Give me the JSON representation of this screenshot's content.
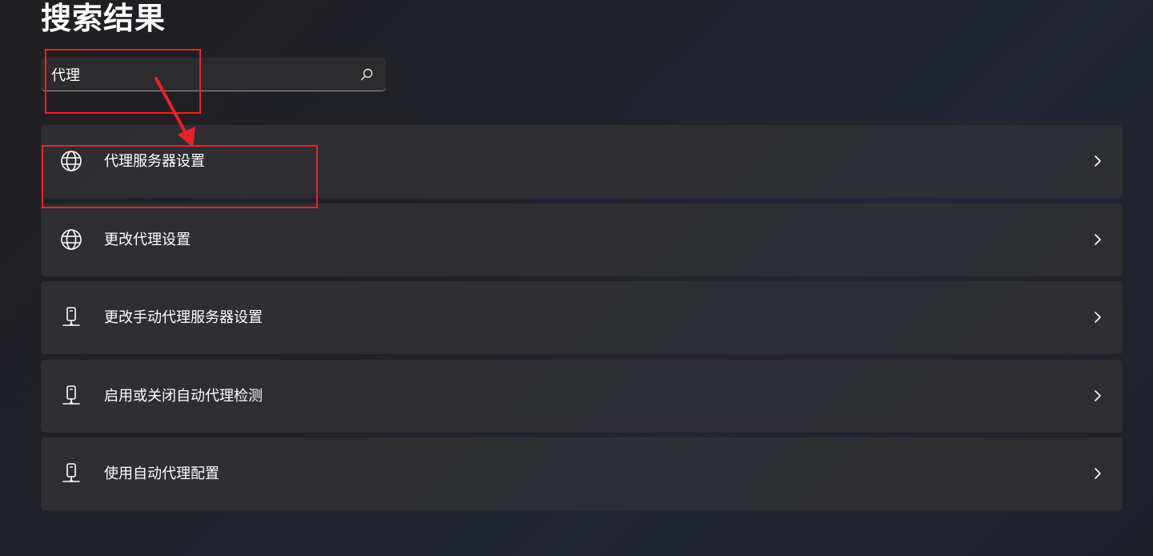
{
  "page": {
    "title": "搜索结果"
  },
  "search": {
    "value": "代理",
    "icon": "search-icon"
  },
  "results": [
    {
      "label": "代理服务器设置",
      "icon": "globe-icon"
    },
    {
      "label": "更改代理设置",
      "icon": "globe-icon"
    },
    {
      "label": "更改手动代理服务器设置",
      "icon": "desktop-tower-icon"
    },
    {
      "label": "启用或关闭自动代理检测",
      "icon": "desktop-tower-icon"
    },
    {
      "label": "使用自动代理配置",
      "icon": "desktop-tower-icon"
    }
  ],
  "colors": {
    "annotation": "#e8232a",
    "text": "#ffffff",
    "card": "#303034"
  }
}
